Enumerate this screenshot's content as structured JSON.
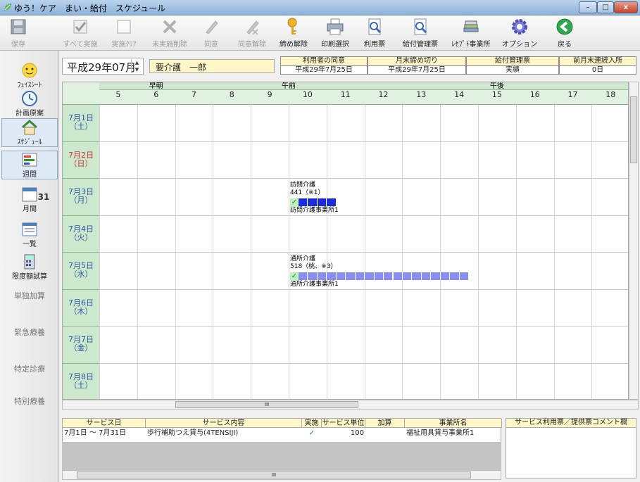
{
  "window": {
    "title": "ゆう！ケア　まい・給付　スケジュール",
    "minimize": "–",
    "maximize": "□",
    "close": "x"
  },
  "toolbar": [
    {
      "id": "save",
      "label": "保存",
      "icon": "floppy-icon",
      "enabled": false
    },
    {
      "id": "execute-all",
      "label": "すべて実施",
      "icon": "check-icon",
      "enabled": false
    },
    {
      "id": "execute-clear",
      "label": "実施ｸﾘｱ",
      "icon": "empty-box-icon",
      "enabled": false
    },
    {
      "id": "delete-unexecuted",
      "label": "未実施削除",
      "icon": "x-icon",
      "enabled": false
    },
    {
      "id": "consent",
      "label": "同意",
      "icon": "pen-icon",
      "enabled": false
    },
    {
      "id": "consent-cancel",
      "label": "同意解除",
      "icon": "pen-cancel-icon",
      "enabled": false
    },
    {
      "id": "close-cancel",
      "label": "締め解除",
      "icon": "key-icon",
      "enabled": true
    },
    {
      "id": "print-select",
      "label": "印刷選択",
      "icon": "printer-icon",
      "enabled": true
    },
    {
      "id": "usage",
      "label": "利用票",
      "icon": "magnifier-doc-icon",
      "enabled": true
    },
    {
      "id": "benefit-mgmt",
      "label": "給付管理票",
      "icon": "magnifier-doc-icon",
      "enabled": true
    },
    {
      "id": "receipt-office",
      "label": "ﾚｾﾌﾟﾄ事業所",
      "icon": "books-icon",
      "enabled": true
    },
    {
      "id": "option",
      "label": "オプション",
      "icon": "gear-icon",
      "enabled": true
    },
    {
      "id": "back",
      "label": "戻る",
      "icon": "back-arrow-icon",
      "enabled": true
    }
  ],
  "sidebar": [
    {
      "id": "face-sheet",
      "label": "ﾌｪｲｽｼｰﾄ",
      "icon": "smiley-icon"
    },
    {
      "id": "plan-draft",
      "label": "計画原案",
      "icon": "clock-icon"
    },
    {
      "id": "schedule",
      "label": "ｽｹｼﾞｭｰﾙ",
      "icon": "house-icon",
      "active": true
    },
    {
      "id": "weekly",
      "label": "週間",
      "icon": "weekly-chart-icon",
      "active": true
    },
    {
      "id": "monthly",
      "label": "月間",
      "icon": "calendar-icon",
      "day": "31"
    },
    {
      "id": "list",
      "label": "一覧",
      "icon": "list-window-icon"
    },
    {
      "id": "limit-calc",
      "label": "限度額試算",
      "icon": "calculator-icon"
    },
    {
      "id": "single-addition",
      "label": "単独加算",
      "plain": true
    },
    {
      "id": "emergency",
      "label": "緊急療養",
      "plain": true
    },
    {
      "id": "specific-diag",
      "label": "特定診療",
      "plain": true
    },
    {
      "id": "special-care",
      "label": "特別療養",
      "plain": true
    }
  ],
  "header": {
    "month": "平成29年07月",
    "spin_up": "▲",
    "spin_down": "▼",
    "client_name": "要介護　一郎",
    "info": [
      {
        "label": "利用者の同意",
        "value": "平成29年7月25日"
      },
      {
        "label": "月末締め切り",
        "value": "平成29年7月25日"
      },
      {
        "label": "給付管理票",
        "value": "実績"
      },
      {
        "label": "前月末連続入所",
        "value": "0日"
      }
    ]
  },
  "grid": {
    "periods": [
      {
        "label": "早朝"
      },
      {
        "label": "午前"
      },
      {
        "label": "午後"
      }
    ],
    "hours": [
      "5",
      "6",
      "7",
      "8",
      "9",
      "10",
      "11",
      "12",
      "13",
      "14",
      "15",
      "16",
      "17",
      "18"
    ],
    "days": [
      {
        "label": "7月1日\n（土）",
        "sunday": false
      },
      {
        "label": "7月2日\n（日）",
        "sunday": true
      },
      {
        "label": "7月3日\n（月）",
        "sunday": false
      },
      {
        "label": "7月4日\n（火）",
        "sunday": false
      },
      {
        "label": "7月5日\n（水）",
        "sunday": false
      },
      {
        "label": "7月6日\n（木）",
        "sunday": false
      },
      {
        "label": "7月7日\n（金）",
        "sunday": false
      },
      {
        "label": "7月8日\n（土）",
        "sunday": false
      }
    ],
    "services": [
      {
        "day_index": 2,
        "name": "訪問介護",
        "units": "441（※1）",
        "office": "訪問介護事業所1",
        "start_hour": 10.0,
        "end_hour": 11.0,
        "color": "#1b2bd6",
        "check": "✓"
      },
      {
        "day_index": 4,
        "name": "通所介護",
        "units": "518（桃、※3）",
        "office": "通所介護事業所1",
        "start_hour": 10.0,
        "end_hour": 14.5,
        "color": "#8a8ef0",
        "check": "✓"
      }
    ],
    "scroll_marker": "III"
  },
  "bottom": {
    "headers": [
      "サービス日",
      "サービス内容",
      "実施",
      "サービス単位",
      "加算",
      "事業所名"
    ],
    "rows": [
      {
        "date": "7月1日 ～ 7月31日",
        "content": "歩行補助つえ貸与(4TENSIJI)",
        "executed": "✓",
        "units": "100",
        "addition": "",
        "office": "福祉用具貸与事業所1"
      }
    ],
    "comment_label": "サービス利用票／提供票コメント欄"
  }
}
